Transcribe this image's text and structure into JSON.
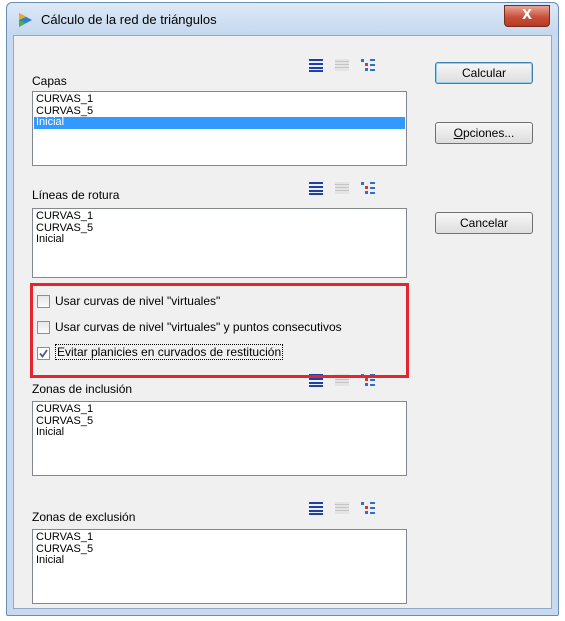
{
  "window": {
    "title": "Cálculo de la red de triángulos",
    "close_glyph": "X"
  },
  "icons": [
    "app-icon",
    "list-view-icon",
    "grid-view-icon",
    "tree-view-icon",
    "checkmark-icon"
  ],
  "groups": [
    {
      "label": "Capas",
      "items": [
        "CURVAS_1",
        "CURVAS_5",
        "Inicial"
      ],
      "selected": "Inicial"
    },
    {
      "label": "Líneas de rotura",
      "items": [
        "CURVAS_1",
        "CURVAS_5",
        "Inicial"
      ]
    },
    {
      "label": "Zonas de inclusión",
      "items": [
        "CURVAS_1",
        "CURVAS_5",
        "Inicial"
      ]
    },
    {
      "label": "Zonas de exclusión",
      "items": [
        "CURVAS_1",
        "CURVAS_5",
        "Inicial"
      ]
    }
  ],
  "options": [
    {
      "label": "Usar curvas de nivel \"virtuales\"",
      "checked": false
    },
    {
      "label": "Usar curvas de nivel \"virtuales\" y puntos consecutivos",
      "checked": false
    },
    {
      "label": "Evitar planicies en curvados de restitución",
      "checked": true
    }
  ],
  "buttons": {
    "calcular": "Calcular",
    "opciones_accel": "O",
    "opciones_rest": "pciones...",
    "cancelar": "Cancelar"
  },
  "colors": {
    "selection": "#3399ff",
    "highlight_box": "#e3262b",
    "close_button": "#c7503b"
  }
}
